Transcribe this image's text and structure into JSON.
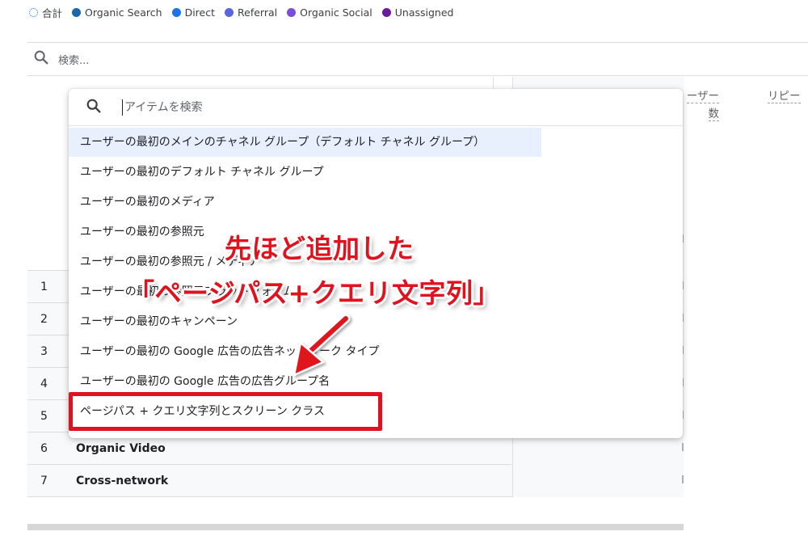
{
  "legend": {
    "items": [
      {
        "label": "合計",
        "color": "#1a73e8",
        "style": "dotted"
      },
      {
        "label": "Organic Search",
        "color": "#1967a8"
      },
      {
        "label": "Direct",
        "color": "#1a73e8"
      },
      {
        "label": "Referral",
        "color": "#5865dc"
      },
      {
        "label": "Organic Social",
        "color": "#7c4ddb"
      },
      {
        "label": "Unassigned",
        "color": "#6a1b9a"
      }
    ]
  },
  "report_search": {
    "placeholder": "検索..."
  },
  "table": {
    "headers": {
      "col_a_line1": "ーザー",
      "col_a_line2": "数",
      "col_b": "リピー"
    },
    "rows": [
      {
        "num": "1",
        "name": ""
      },
      {
        "num": "2",
        "name": ""
      },
      {
        "num": "3",
        "name": ""
      },
      {
        "num": "4",
        "name": ""
      },
      {
        "num": "5",
        "name": ""
      },
      {
        "num": "6",
        "name": "Organic Video"
      },
      {
        "num": "7",
        "name": "Cross-network"
      }
    ]
  },
  "dropdown": {
    "search_placeholder": "アイテムを検索",
    "options": [
      "ユーザーの最初のメインのチャネル グループ（デフォルト チャネル グループ）",
      "ユーザーの最初のデフォルト チャネル グループ",
      "ユーザーの最初のメディア",
      "ユーザーの最初の参照元",
      "ユーザーの最初の参照元 / メディア",
      "ユーザーの最初の参照元プラットフォーム",
      "ユーザーの最初のキャンペーン",
      "ユーザーの最初の Google 広告の広告ネットワーク タイプ",
      "ユーザーの最初の Google 広告の広告グループ名",
      "ページパス + クエリ文字列とスクリーン クラス"
    ]
  },
  "annotation": {
    "line1": "先ほど追加した",
    "line2": "「ページパス+クエリ文字列」",
    "color": "#e0121e"
  },
  "icons": {
    "search": "search-icon"
  }
}
